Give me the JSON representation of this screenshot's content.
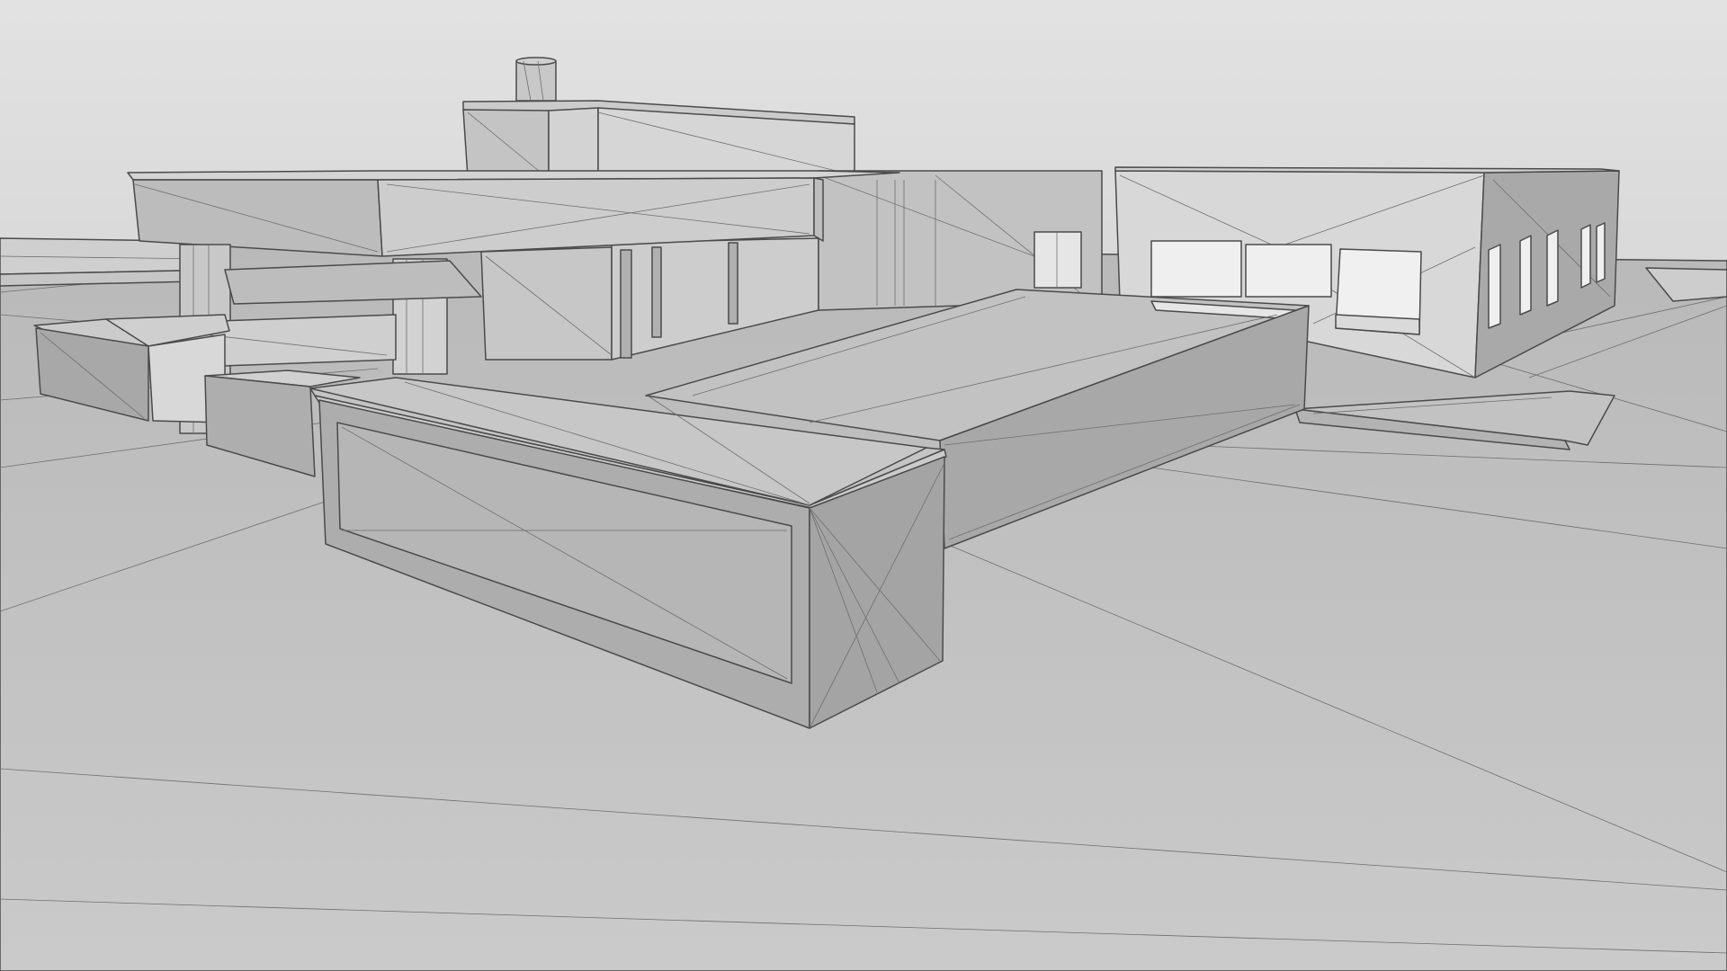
{
  "viewport": {
    "mode": "3d-model-viewport",
    "render_style": "shaded-wireframe",
    "colors": {
      "sky": "#dcdcdc",
      "ground": "#bdbdbd",
      "model_light": "#d3d3d3",
      "model_mid": "#b5b5b5",
      "model_dark": "#9a9a9a",
      "edge": "#4a4a4a"
    }
  }
}
